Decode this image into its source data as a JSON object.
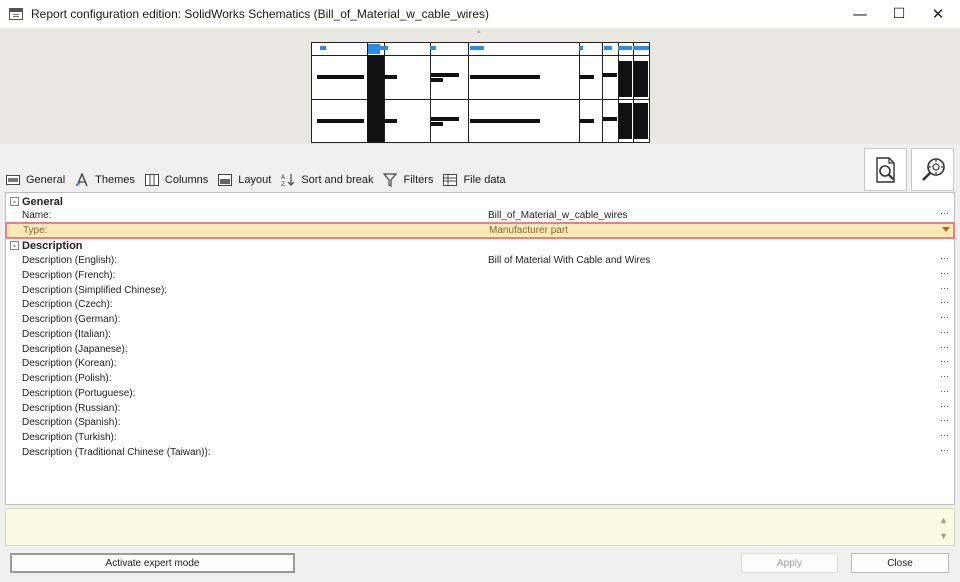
{
  "window": {
    "title": "Report configuration edition: SolidWorks Schematics (Bill_of_Material_w_cable_wires)",
    "minimize": "—",
    "maximize": "☐",
    "close": "✕"
  },
  "toolbar": {
    "tabs": [
      {
        "label": "General",
        "icon": "general-icon"
      },
      {
        "label": "Themes",
        "icon": "themes-icon"
      },
      {
        "label": "Columns",
        "icon": "columns-icon"
      },
      {
        "label": "Layout",
        "icon": "layout-icon"
      },
      {
        "label": "Sort and break",
        "icon": "sort-icon"
      },
      {
        "label": "Filters",
        "icon": "filter-icon"
      },
      {
        "label": "File data",
        "icon": "file-data-icon"
      }
    ]
  },
  "properties": {
    "general": {
      "label": "General",
      "toggle": "-",
      "rows": [
        {
          "key": "Name:",
          "value": "Bill_of_Material_w_cable_wires",
          "ellipsis": "···"
        },
        {
          "key": "Type:",
          "value": "Manufacturer part"
        }
      ]
    },
    "description": {
      "label": "Description",
      "toggle": "-",
      "rows": [
        {
          "key": "Description (English):",
          "value": "Bill of Material With Cable and Wires",
          "ellipsis": "···"
        },
        {
          "key": "Description (French):",
          "value": "",
          "ellipsis": "···"
        },
        {
          "key": "Description (Simplified Chinese):",
          "value": "",
          "ellipsis": "···"
        },
        {
          "key": "Description (Czech):",
          "value": "",
          "ellipsis": "···"
        },
        {
          "key": "Description (German):",
          "value": "",
          "ellipsis": "···"
        },
        {
          "key": "Description (Italian):",
          "value": "",
          "ellipsis": "···"
        },
        {
          "key": "Description (Japanese):",
          "value": "",
          "ellipsis": "···"
        },
        {
          "key": "Description (Korean):",
          "value": "",
          "ellipsis": "···"
        },
        {
          "key": "Description (Polish):",
          "value": "",
          "ellipsis": "···"
        },
        {
          "key": "Description (Portuguese):",
          "value": "",
          "ellipsis": "···"
        },
        {
          "key": "Description (Russian):",
          "value": "",
          "ellipsis": "···"
        },
        {
          "key": "Description (Spanish):",
          "value": "",
          "ellipsis": "···"
        },
        {
          "key": "Description (Turkish):",
          "value": "",
          "ellipsis": "···"
        },
        {
          "key": "Description (Traditional Chinese (Taiwan)):",
          "value": "",
          "ellipsis": "···"
        }
      ]
    }
  },
  "footer": {
    "expert_label": "Activate expert mode",
    "apply_label": "Apply",
    "close_label": "Close",
    "scroll_up": "▲",
    "scroll_down": "▼"
  },
  "colors": {
    "selected_row_bg": "#fbeab7",
    "selected_row_border": "#e8808a",
    "preview_accent": "#2d8be6",
    "description_bg": "#fbfae3"
  }
}
